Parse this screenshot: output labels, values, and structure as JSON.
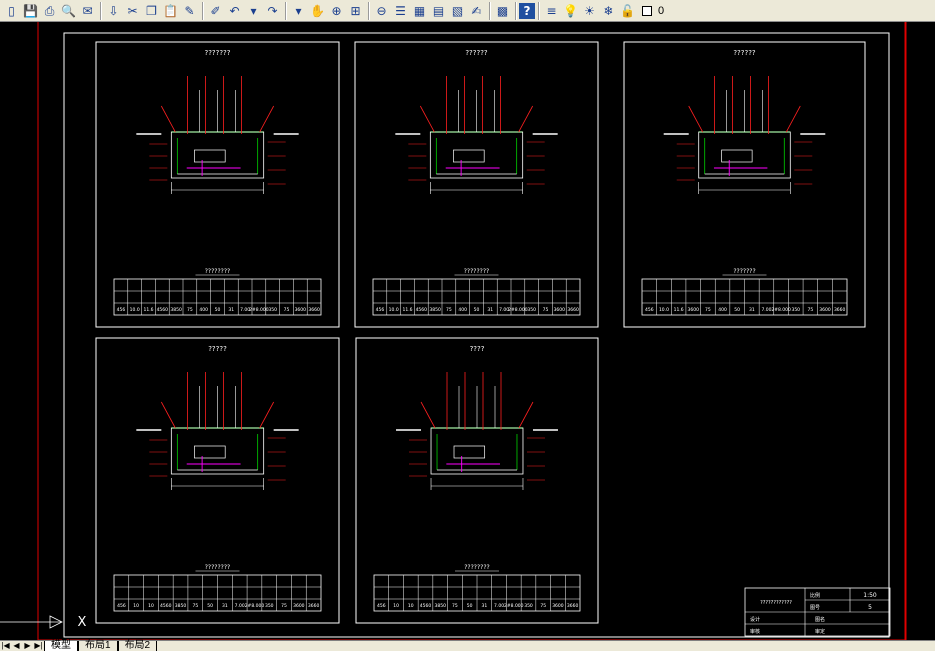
{
  "toolbar": {
    "icons": [
      "new-icon",
      "save-icon",
      "print-icon",
      "preview-icon",
      "publish-icon",
      "plot-icon",
      "cut-icon",
      "copy-icon",
      "paste-icon",
      "brush-icon",
      "match-icon",
      "undo-icon",
      "undo-drop-icon",
      "redo-icon",
      "redo-drop-icon",
      "pan-icon",
      "zoom-realtime-icon",
      "zoom-window-icon",
      "zoom-previous-icon",
      "properties-icon",
      "design-center-icon",
      "tool-palette-icon",
      "sheet-set-icon",
      "markup-icon",
      "calculator-icon",
      "help-icon",
      "layer-manager-icon",
      "bulb-icon",
      "sun-icon",
      "freeze-icon",
      "lock-icon",
      "color-swatch-icon"
    ],
    "layer_name": "0"
  },
  "tabs": {
    "model": "模型",
    "layout1": "布局1",
    "layout2": "布局2"
  },
  "drawing": {
    "sheets": [
      {
        "title": "???????",
        "table_title": "????????",
        "values": [
          "456",
          "10.0",
          "11.6",
          "4560",
          "3850",
          "75",
          "400",
          "50",
          "31",
          "7.00",
          "2#8.000",
          "350",
          "75",
          "3600",
          "3660"
        ]
      },
      {
        "title": "??????",
        "table_title": "????????",
        "values": [
          "456",
          "10.0",
          "11.6",
          "4560",
          "3850",
          "75",
          "400",
          "50",
          "31",
          "7.00",
          "2#8.000",
          "350",
          "75",
          "3600",
          "3660"
        ]
      },
      {
        "title": "??????",
        "table_title": "???????",
        "values": [
          "456",
          "10.0",
          "11.6",
          "3600",
          "75",
          "400",
          "50",
          "31",
          "7.00",
          "2#8.000",
          "350",
          "75",
          "3600",
          "3660"
        ]
      },
      {
        "title": "?????",
        "table_title": "????????",
        "values": [
          "456",
          "10",
          "10",
          "4560",
          "3850",
          "75",
          "50",
          "31",
          "7.00",
          "2#8.000",
          "350",
          "75",
          "3600",
          "3660"
        ]
      },
      {
        "title": "????",
        "table_title": "????????",
        "values": [
          "456",
          "10",
          "10",
          "4560",
          "3850",
          "75",
          "50",
          "31",
          "7.00",
          "2#8.000",
          "350",
          "75",
          "3600",
          "3660"
        ]
      }
    ],
    "title_block": {
      "drawing_name": "????????????",
      "scale_label": "比例",
      "scale_value": "1:50",
      "sheet_label": "图号",
      "sheet_value": "5",
      "designer_label": "设计",
      "checker_label": "审核",
      "row_label_a": "图名",
      "row_label_b": "审定"
    },
    "colors": {
      "border": "#e00000",
      "paper": "#ffffff",
      "dim": "#ff2020",
      "structure": "#00d000",
      "rebar": "#ff00ff",
      "text": "#ffffff"
    }
  }
}
